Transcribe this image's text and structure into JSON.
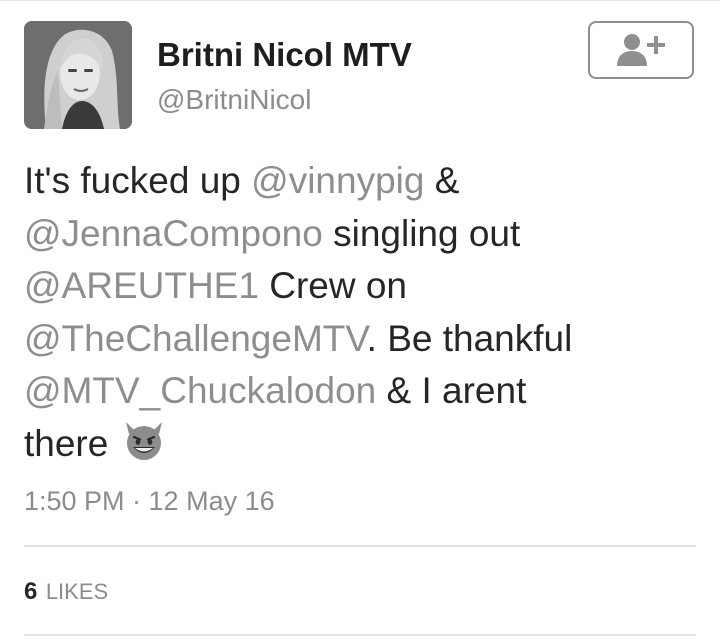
{
  "tweet": {
    "author": {
      "display_name": "Britni Nicol MTV",
      "handle": "@BritniNicol"
    },
    "text_lines": [
      [
        {
          "text": "It's fucked up ",
          "mention": false
        },
        {
          "text": "@vinnypig",
          "mention": true
        },
        {
          "text": " &",
          "mention": false
        }
      ],
      [
        {
          "text": "@JennaCompono",
          "mention": true
        },
        {
          "text": " singling out",
          "mention": false
        }
      ],
      [
        {
          "text": "@AREUTHE1",
          "mention": true
        },
        {
          "text": " Crew on",
          "mention": false
        }
      ],
      [
        {
          "text": "@TheChallengeMTV",
          "mention": true
        },
        {
          "text": ". Be thankful",
          "mention": false
        }
      ],
      [
        {
          "text": "@MTV_Chuckalodon",
          "mention": true
        },
        {
          "text": " & I arent",
          "mention": false
        }
      ],
      [
        {
          "text": "there",
          "mention": false
        }
      ]
    ],
    "emoji": "smiling-devil-icon",
    "timestamp": "1:50 PM · 12 May 16",
    "likes_count": "6",
    "likes_label": "LIKES"
  },
  "colors": {
    "text": "#262626",
    "mention": "#8e8e8e",
    "muted": "#8c8c8c",
    "divider": "#e3e3e3",
    "button_border": "#8f8f8f"
  }
}
